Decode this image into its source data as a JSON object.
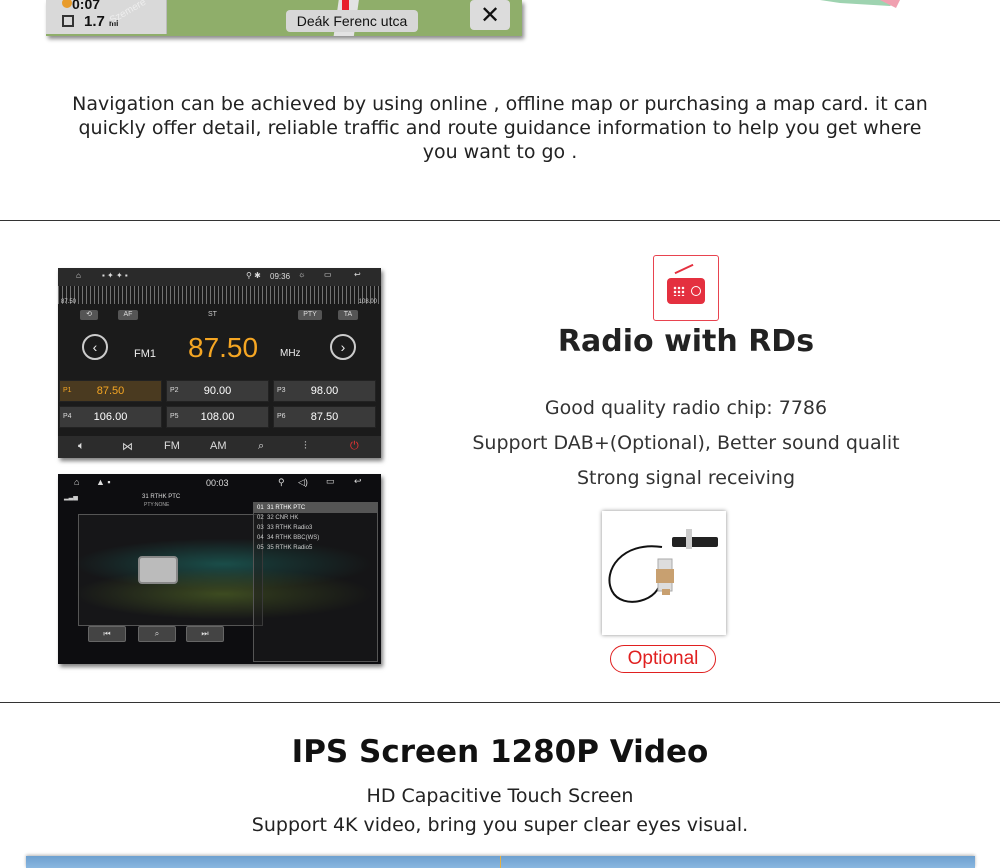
{
  "nav_screenshot": {
    "time": "0:07",
    "distance_value": "1.7",
    "distance_unit": "mi",
    "diagonal_text": "Szemere",
    "street_name": "Deák Ferenc utca",
    "close_glyph": "✕"
  },
  "navigation_text": "Navigation can be achieved by using online , offline map or purchasing a map card. it can quickly offer detail, reliable traffic and route guidance information to help you get where you want to go .",
  "radio_screenshot": {
    "status_time": "09:36",
    "dial_min": "87.50",
    "dial_max": "108.00",
    "af": "AF",
    "st": "ST",
    "pty": "PTY",
    "ta": "TA",
    "band": "FM1",
    "frequency": "87.50",
    "unit": "MHz",
    "presets": [
      {
        "num": "P1",
        "value": "87.50"
      },
      {
        "num": "P2",
        "value": "90.00"
      },
      {
        "num": "P3",
        "value": "98.00"
      },
      {
        "num": "P4",
        "value": "106.00"
      },
      {
        "num": "P5",
        "value": "108.00"
      },
      {
        "num": "P6",
        "value": "87.50"
      }
    ],
    "bottom_fm": "FM",
    "bottom_am": "AM"
  },
  "player_screenshot": {
    "time": "00:03",
    "station": "31 RTHK PTC",
    "pty": "PTY:NONE",
    "list": [
      {
        "num": "01",
        "name": "31 RTHK PTC"
      },
      {
        "num": "02",
        "name": "32 CNR HK"
      },
      {
        "num": "03",
        "name": "33 RTHK Radio3"
      },
      {
        "num": "04",
        "name": "34 RTHK BBC(WS)"
      },
      {
        "num": "05",
        "name": "35 RTHK Radio5"
      }
    ]
  },
  "radio_section": {
    "title": "Radio with RDs",
    "features": [
      "Good quality radio chip: 7786",
      "Support DAB+(Optional), Better sound qualit",
      "Strong signal receiving"
    ],
    "optional_label": "Optional",
    "icon_color": "#e4303f"
  },
  "ips_section": {
    "title": "IPS Screen 1280P Video",
    "line1": "HD Capacitive Touch Screen",
    "line2": "Support 4K video, bring you super clear eyes visual."
  }
}
